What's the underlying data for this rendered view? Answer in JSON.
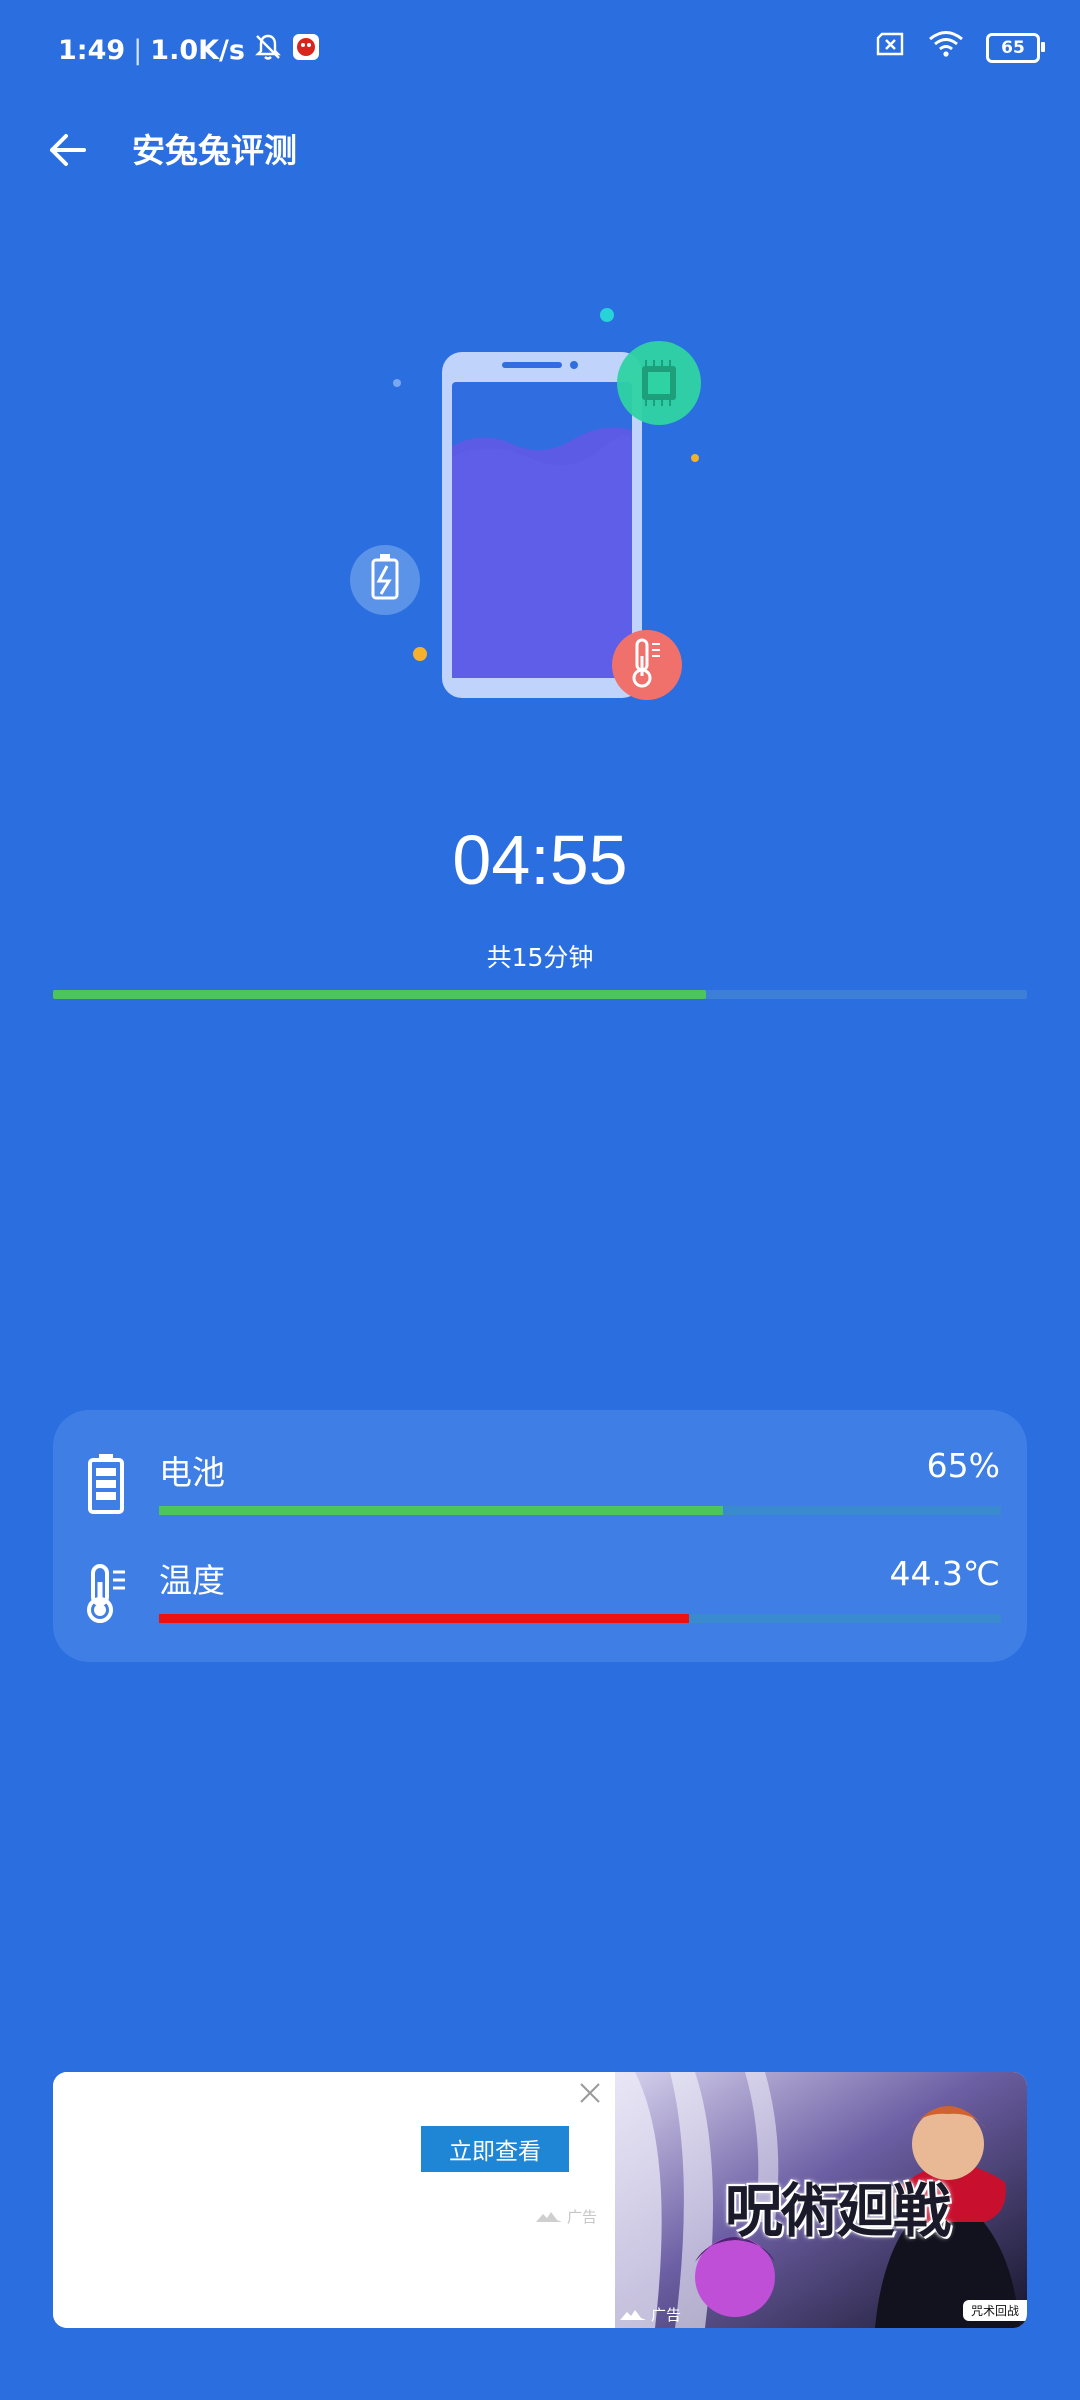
{
  "status_bar": {
    "time": "1:49",
    "network_speed": "1.0K/s",
    "battery_level": "65"
  },
  "app_bar": {
    "title": "安兔兔评测"
  },
  "test": {
    "elapsed": "04:55",
    "total_label": "共15分钟",
    "progress_fraction": 0.67
  },
  "stats": {
    "battery": {
      "label": "电池",
      "value": "65%",
      "level_fraction": 0.67,
      "bar_color": "#4dc55e"
    },
    "temperature": {
      "label": "温度",
      "value": "44.3℃",
      "level_fraction": 0.63,
      "bar_color": "#ee1111"
    }
  },
  "ad": {
    "cta_label": "立即查看",
    "ad_mark_label": "广告",
    "image_title": "呪術廻戦",
    "badge_label": "咒术回战"
  },
  "colors": {
    "background": "#2a6ee0",
    "card": "#3f7ee4",
    "progress_fill": "#4dc55e"
  }
}
